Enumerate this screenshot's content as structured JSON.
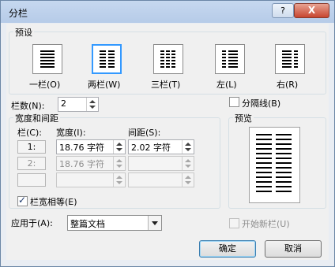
{
  "window": {
    "title": "分栏",
    "help_glyph": "?",
    "close_glyph": "X"
  },
  "presets": {
    "group_label": "预设",
    "items": [
      {
        "label": "一栏(O)",
        "icon": "one-column-icon"
      },
      {
        "label": "两栏(W)",
        "icon": "two-columns-icon"
      },
      {
        "label": "三栏(T)",
        "icon": "three-columns-icon"
      },
      {
        "label": "左(L)",
        "icon": "left-column-icon"
      },
      {
        "label": "右(R)",
        "icon": "right-column-icon"
      }
    ],
    "selected": "两栏(W)"
  },
  "columns_count": {
    "label": "栏数(N):",
    "value": "2"
  },
  "separator": {
    "label": "分隔线(B)",
    "checked": false
  },
  "width_spacing": {
    "group_label": "宽度和间距",
    "headers": {
      "col": "栏(C):",
      "width": "宽度(I):",
      "spacing": "间距(S):"
    },
    "rows": [
      {
        "num": "1:",
        "width": "18.76 字符",
        "spacing": "2.02 字符",
        "enabled": true
      },
      {
        "num": "2:",
        "width": "18.76 字符",
        "spacing": "",
        "enabled": false
      },
      {
        "num": "",
        "width": "",
        "spacing": "",
        "enabled": false
      }
    ]
  },
  "equal_width": {
    "label": "栏宽相等(E)",
    "checked": true
  },
  "preview": {
    "group_label": "预览"
  },
  "apply_to": {
    "label": "应用于(A):",
    "value": "整篇文档"
  },
  "new_column": {
    "label": "开始新栏(U)",
    "checked": false,
    "enabled": false
  },
  "buttons": {
    "ok": "确定",
    "cancel": "取消"
  },
  "colors": {
    "selection": "#3399ff",
    "title_bar": "#c6d8ef",
    "close": "#c7452f"
  }
}
